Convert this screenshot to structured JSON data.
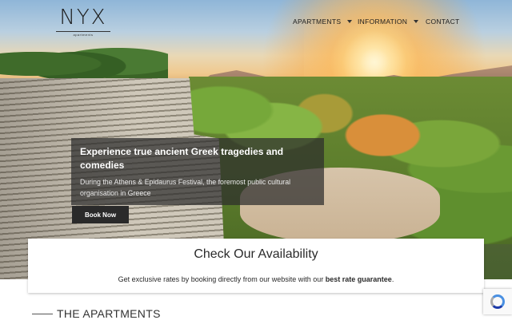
{
  "header": {
    "logo_text": "NYX",
    "logo_sub": "apartments",
    "nav": [
      {
        "label": "APARTMENTS"
      },
      {
        "label": "INFORMATION"
      },
      {
        "label": "CONTACT"
      }
    ]
  },
  "hero": {
    "title": "Experience true ancient Greek tragedies and comedies",
    "text": "During the Athens & Epidaurus Festival, the foremost public cultural organisation in Greece",
    "button_label": "Book Now"
  },
  "availability": {
    "title": "Check Our Availability",
    "text_prefix": "Get exclusive rates by booking directly from our website with our ",
    "text_bold": "best rate guarantee",
    "text_suffix": "."
  },
  "section": {
    "title": "THE APARTMENTS"
  },
  "icons": {
    "nav_dropdown": "chevron-down-icon",
    "recaptcha": "recaptcha-icon"
  }
}
